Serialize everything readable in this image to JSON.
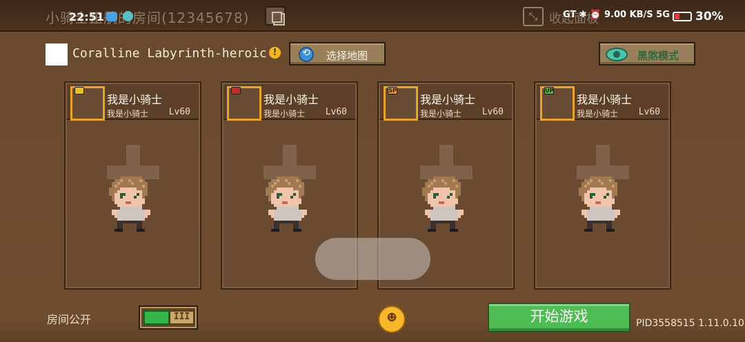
{
  "header": {
    "room_title": "小骑士正航的房间(12345678)",
    "collapse_label": "收起面板"
  },
  "status_bar": {
    "time": "22:51",
    "right_icons": "GT ✱ ⏰ 9.00 KB/S 5G",
    "battery": "30%"
  },
  "map": {
    "name": "Coralline Labyrinth-heroic",
    "warning": "!",
    "select_map_label": "选择地图",
    "dark_mode_label": "黑煞模式"
  },
  "players": [
    {
      "name": "我是小骑士",
      "hero": "我是小骑士",
      "level": "Lv60",
      "badge_color": "#e8c020",
      "badge": ""
    },
    {
      "name": "我是小骑士",
      "hero": "我是小骑士",
      "level": "Lv60",
      "badge_color": "#c0302a",
      "badge": ""
    },
    {
      "name": "我是小骑士",
      "hero": "我是小骑士",
      "level": "Lv60",
      "badge_color": "#e89a20",
      "badge": "SP"
    },
    {
      "name": "我是小骑士",
      "hero": "我是小骑士",
      "level": "Lv60",
      "badge_color": "#58b840",
      "badge": "UP"
    }
  ],
  "footer": {
    "room_public_label": "房间公开",
    "toggle_knob": "III",
    "start_label": "开始游戏",
    "pid": "PID3558515 1.11.0.10"
  },
  "colors": {
    "accent_green": "#4cbc53",
    "slot_border": "#e8a52a"
  }
}
